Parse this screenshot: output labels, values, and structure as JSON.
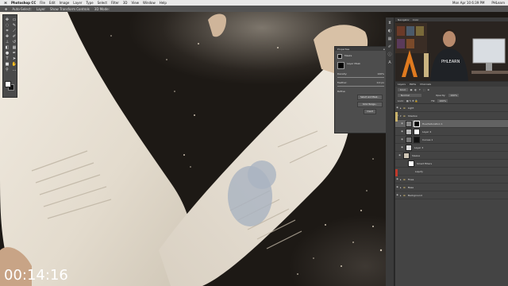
{
  "menubar": {
    "apple": "⌘",
    "app": "Photoshop CC",
    "menus": [
      "File",
      "Edit",
      "Image",
      "Layer",
      "Type",
      "Select",
      "Filter",
      "3D",
      "View",
      "Window",
      "Help"
    ],
    "clock": "Mon Apr 10  6:39 PM",
    "user": "PHLearn"
  },
  "options": {
    "items": [
      "Auto-Select:",
      "Layer",
      "Show Transform Controls",
      "3D Mode:"
    ]
  },
  "properties": {
    "title": "Properties",
    "section": "Masks",
    "subtitle": "Layer Mask",
    "density_label": "Density:",
    "density_value": "100%",
    "feather_label": "Feather:",
    "feather_value": "0.0 px",
    "refine_label": "Refine:",
    "buttons": [
      "Select and Mask...",
      "Color Range...",
      "Invert"
    ]
  },
  "navigator": {
    "tabs": [
      "Navigator",
      "Color"
    ],
    "overlay_text": "PHLEARN"
  },
  "layers": {
    "tabs": [
      "Layers",
      "Paths",
      "Channels"
    ],
    "kind_label": "Kind",
    "blend_mode": "Normal",
    "opacity_label": "Opacity:",
    "opacity_value": "100%",
    "lock_label": "Lock:",
    "fill_label": "Fill:",
    "fill_value": "100%",
    "rows": [
      {
        "name": "Light",
        "type": "group"
      },
      {
        "name": "Shadow",
        "type": "group"
      },
      {
        "name": "Hue/Saturation 1",
        "type": "adj",
        "selected": true
      },
      {
        "name": "Layer 4",
        "type": "layer"
      },
      {
        "name": "Curves 1",
        "type": "adj"
      },
      {
        "name": "Layer 3",
        "type": "layer"
      },
      {
        "name": "Sleeve",
        "type": "layer"
      },
      {
        "name": "Smart Filters",
        "type": "sub"
      },
      {
        "name": "Liquify",
        "type": "sub"
      },
      {
        "name": "Fixes",
        "type": "group"
      },
      {
        "name": "Base",
        "type": "group"
      },
      {
        "name": "Background",
        "type": "layer"
      }
    ]
  },
  "timecode": "00:14:16",
  "colors": {
    "fabric": "#e8e0d2",
    "panel": "#444444",
    "selected_row": "#626262",
    "accent_red": "#c0392b"
  }
}
